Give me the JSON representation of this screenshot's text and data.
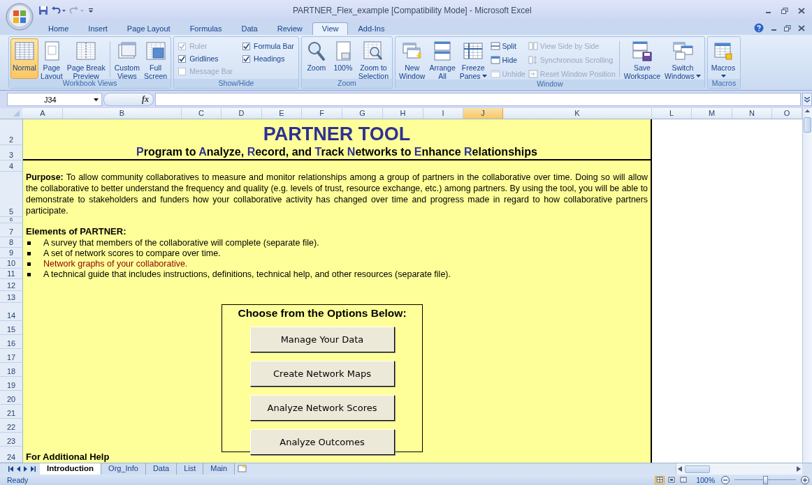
{
  "window": {
    "title": "PARTNER_Flex_example  [Compatibility Mode] - Microsoft Excel"
  },
  "ribbon_tabs": [
    {
      "label": "Home",
      "selected": false
    },
    {
      "label": "Insert",
      "selected": false
    },
    {
      "label": "Page Layout",
      "selected": false
    },
    {
      "label": "Formulas",
      "selected": false
    },
    {
      "label": "Data",
      "selected": false
    },
    {
      "label": "Review",
      "selected": false
    },
    {
      "label": "View",
      "selected": true
    },
    {
      "label": "Add-Ins",
      "selected": false
    }
  ],
  "ribbon_groups": [
    {
      "label": "Workbook Views",
      "items": [
        {
          "kind": "large",
          "label": "Normal",
          "selected": true
        },
        {
          "kind": "large",
          "label": "Page\nLayout",
          "selected": false
        },
        {
          "kind": "large",
          "label": "Page Break\nPreview",
          "selected": false
        },
        {
          "kind": "separator"
        },
        {
          "kind": "large",
          "label": "Custom\nViews",
          "selected": false
        },
        {
          "kind": "large",
          "label": "Full\nScreen",
          "selected": false
        }
      ]
    },
    {
      "label": "Show/Hide",
      "items": [
        {
          "kind": "checkbox",
          "label": "Ruler",
          "checked": true,
          "disabled": true
        },
        {
          "kind": "checkbox",
          "label": "Gridlines",
          "checked": true,
          "disabled": false
        },
        {
          "kind": "checkbox",
          "label": "Message Bar",
          "checked": false,
          "disabled": true
        },
        {
          "kind": "checkbox",
          "label": "Formula Bar",
          "checked": true,
          "disabled": false
        },
        {
          "kind": "checkbox",
          "label": "Headings",
          "checked": true,
          "disabled": false
        }
      ]
    },
    {
      "label": "Zoom",
      "items": [
        {
          "kind": "large",
          "label": "Zoom"
        },
        {
          "kind": "large",
          "label": "100%"
        },
        {
          "kind": "large",
          "label": "Zoom to\nSelection"
        }
      ]
    },
    {
      "label": "Window",
      "items": [
        {
          "kind": "large",
          "label": "New\nWindow"
        },
        {
          "kind": "large",
          "label": "Arrange\nAll"
        },
        {
          "kind": "large",
          "label": "Freeze\nPanes",
          "dropdown": true
        },
        {
          "kind": "small",
          "label": "Split",
          "disabled": false
        },
        {
          "kind": "small",
          "label": "Hide",
          "disabled": false
        },
        {
          "kind": "small",
          "label": "Unhide",
          "disabled": true
        },
        {
          "kind": "small",
          "label": "View Side by Side",
          "disabled": true
        },
        {
          "kind": "small",
          "label": "Synchronous Scrolling",
          "disabled": true
        },
        {
          "kind": "small",
          "label": "Reset Window Position",
          "disabled": true
        },
        {
          "kind": "separator"
        },
        {
          "kind": "large",
          "label": "Save\nWorkspace"
        },
        {
          "kind": "large",
          "label": "Switch\nWindows",
          "dropdown": true
        }
      ]
    },
    {
      "label": "Macros",
      "items": [
        {
          "kind": "large",
          "label": "Macros",
          "dropdown": true
        }
      ]
    }
  ],
  "formula_bar": {
    "name_box": "J34",
    "function_label": "fx"
  },
  "columns": [
    {
      "label": "A",
      "selected": false
    },
    {
      "label": "B",
      "selected": false
    },
    {
      "label": "C",
      "selected": false
    },
    {
      "label": "D",
      "selected": false
    },
    {
      "label": "E",
      "selected": false
    },
    {
      "label": "F",
      "selected": false
    },
    {
      "label": "G",
      "selected": false
    },
    {
      "label": "H",
      "selected": false
    },
    {
      "label": "I",
      "selected": false
    },
    {
      "label": "J",
      "selected": true
    },
    {
      "label": "K",
      "selected": false
    },
    {
      "label": "L",
      "selected": false
    },
    {
      "label": "M",
      "selected": false
    },
    {
      "label": "N",
      "selected": false
    },
    {
      "label": "O",
      "selected": false
    }
  ],
  "rows": [
    {
      "number": "2",
      "kind": "title",
      "text": "PARTNER TOOL"
    },
    {
      "number": "3",
      "kind": "subtitle",
      "segments": [
        {
          "text": "P",
          "accent": true
        },
        {
          "text": "rogram to ",
          "accent": false
        },
        {
          "text": "A",
          "accent": true
        },
        {
          "text": "nalyze, ",
          "accent": false
        },
        {
          "text": "R",
          "accent": true
        },
        {
          "text": "ecord, and ",
          "accent": false
        },
        {
          "text": "T",
          "accent": true
        },
        {
          "text": "rack ",
          "accent": false
        },
        {
          "text": "N",
          "accent": true
        },
        {
          "text": "etworks to ",
          "accent": false
        },
        {
          "text": "E",
          "accent": true
        },
        {
          "text": "nhance ",
          "accent": false
        },
        {
          "text": "R",
          "accent": true
        },
        {
          "text": "elationships",
          "accent": false
        }
      ]
    },
    {
      "number": "4",
      "kind": "empty"
    },
    {
      "number": "5",
      "kind": "paragraph",
      "text": "**Purpose:**  To allow community collaboratives to measure and monitor relationships among a group of partners in the collaborative over time.  Doing so will allow the collaborative to better understand the frequency and quality (e.g. levels of trust, resource exchange, etc.) among partners. By using the tool, you will be able to demonstrate to stakeholders and funders how your collaborative activity has changed over time and progress made in regard to how collaborative partners participate."
    },
    {
      "number": "6",
      "kind": "empty"
    },
    {
      "number": "7",
      "kind": "heading",
      "text": "Elements of PARTNER:"
    },
    {
      "number": "8",
      "kind": "bullet",
      "text": "A survey that members of the collaborative will complete (separate file).",
      "color": "#000000"
    },
    {
      "number": "9",
      "kind": "bullet",
      "text": "A set of network scores to compare over time.",
      "color": "#000000"
    },
    {
      "number": "10",
      "kind": "bullet",
      "text": "Network graphs of your collaborative.",
      "color": "#8b0000"
    },
    {
      "number": "11",
      "kind": "bullet",
      "text": "A technical guide that includes instructions, definitions, technical help, and other resources (separate file).",
      "color": "#000000"
    },
    {
      "number": "12",
      "kind": "empty"
    },
    {
      "number": "13",
      "kind": "empty"
    },
    {
      "number": "14",
      "kind": "empty"
    },
    {
      "number": "15",
      "kind": "empty"
    },
    {
      "number": "16",
      "kind": "empty"
    },
    {
      "number": "17",
      "kind": "empty"
    },
    {
      "number": "18",
      "kind": "empty"
    },
    {
      "number": "19",
      "kind": "empty"
    },
    {
      "number": "20",
      "kind": "empty"
    },
    {
      "number": "21",
      "kind": "empty"
    },
    {
      "number": "22",
      "kind": "empty"
    },
    {
      "number": "23",
      "kind": "empty"
    },
    {
      "number": "24",
      "kind": "heading",
      "text": "For Additional Help"
    }
  ],
  "options_box": {
    "heading": "Choose from the Options Below:",
    "buttons": [
      "Manage Your Data",
      "Create Network Maps",
      "Analyze Network Scores",
      "Analyze Outcomes"
    ]
  },
  "sheet_tabs": [
    {
      "label": "Introduction",
      "selected": true
    },
    {
      "label": "Org_Info",
      "selected": false
    },
    {
      "label": "Data",
      "selected": false
    },
    {
      "label": "List",
      "selected": false
    },
    {
      "label": "Main",
      "selected": false
    }
  ],
  "status_bar": {
    "text": "Ready",
    "view_buttons": [
      {
        "selected": true
      },
      {
        "selected": false
      },
      {
        "selected": false
      }
    ],
    "zoom": "100%",
    "zoom_slider": {
      "level": 0.5
    }
  }
}
